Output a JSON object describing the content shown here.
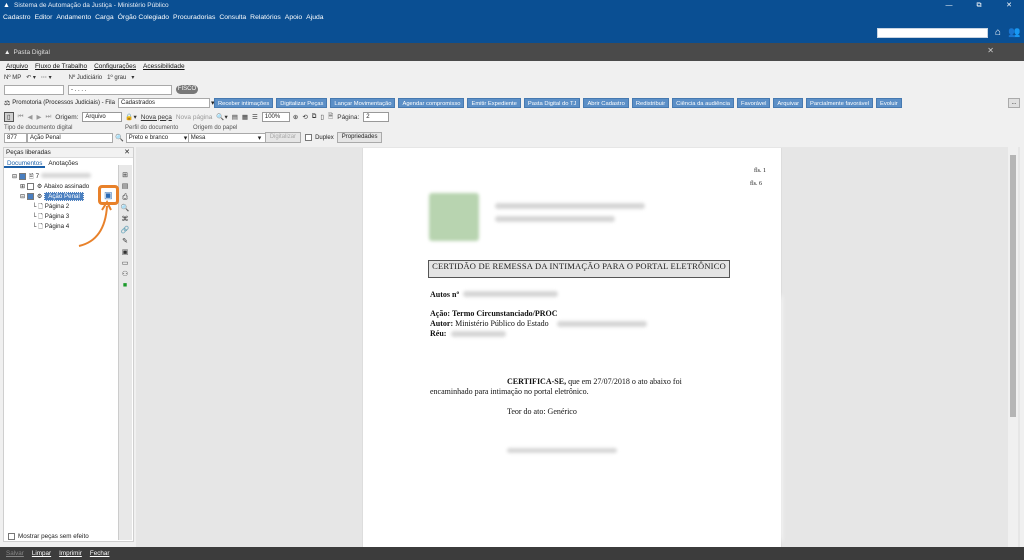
{
  "window": {
    "title": "Sistema de Automação da Justiça - Ministério Público",
    "controls": [
      "—",
      "⧉",
      "✕"
    ]
  },
  "menu": [
    "Cadastro",
    "Editor",
    "Andamento",
    "Carga",
    "Órgão Colegiado",
    "Procuradorias",
    "Consulta",
    "Relatórios",
    "Apoio",
    "Ajuda"
  ],
  "inner_window": {
    "title": "Pasta Digital",
    "close": "✕"
  },
  "submenu": [
    "Arquivo",
    "Fluxo de Trabalho",
    "Configurações",
    "Acessibilidade"
  ],
  "header_row": {
    "nmp_label": "Nº MP",
    "njud_label": "Nº Judiciário",
    "grau": "1º grau",
    "njud_value": "- . . . .",
    "pill": "FISCO"
  },
  "process": {
    "label": "Promotoria (Processos Judiciais) - Fila",
    "queue": "Cadastrados"
  },
  "actions": [
    "Receber intimações",
    "Digitalizar Peças",
    "Lançar Movimentação",
    "Agendar compromisso",
    "Emitir Expediente",
    "Pasta Digital do TJ",
    "Abrir Cadastro",
    "Redistribuir",
    "Ciência da audiência",
    "Favorável",
    "Arquivar",
    "Parcialmente favorável",
    "Evoluir"
  ],
  "more": "...",
  "toolbar": {
    "origem_label": "Origem:",
    "origem_value": "Arquivo",
    "nova_peca": "Nova peça",
    "nova_pagina": "Nova página",
    "zoom": "100%",
    "pagina_label": "Página:",
    "pagina_value": "2"
  },
  "row5": {
    "tipo_label": "Tipo de documento digital",
    "perfil_label": "Perfil do documento",
    "origem_papel_label": "Origem do papel",
    "tipo_code": "877",
    "tipo_value": "Ação Penal",
    "perfil_value": "Preto e branco",
    "papel_value": "Mesa",
    "digitalizar": "Digitalizar",
    "duplex": "Duplex",
    "propriedades": "Propriedades"
  },
  "left_pane": {
    "title": "Peças liberadas",
    "close": "✕",
    "tabs": [
      "Documentos",
      "Anotações"
    ],
    "node_root": "7",
    "node_abaixo": "Abaixo assinado",
    "node_acao": "Ação Penal",
    "pages": [
      "Página 2",
      "Página 3",
      "Página 4"
    ],
    "mostrar": "Mostrar peças sem efeito"
  },
  "doc": {
    "fls1": "fls. 1",
    "fls2": "fls. 6",
    "cert_title": "CERTIDÃO  DE REMESSA DA INTIMAÇÃO PARA O PORTAL ELETRÔNICO",
    "autos": "Autos nº",
    "acao_label": "Ação:",
    "acao_value": "Termo Circunstanciado/PROC",
    "autor_label": "Autor:",
    "autor_value": "Ministério Público do Estado",
    "reu_label": "Réu:",
    "certifica": "CERTIFICA-SE,",
    "certifica_rest": "que em 27/07/2018 o ato abaixo foi",
    "certifica_line2": "encaminhado para intimação no portal  eletrônico.",
    "teor": "Teor do ato: Genérico"
  },
  "bottom": [
    "Salvar",
    "Limpar",
    "Imprimir",
    "Fechar"
  ]
}
